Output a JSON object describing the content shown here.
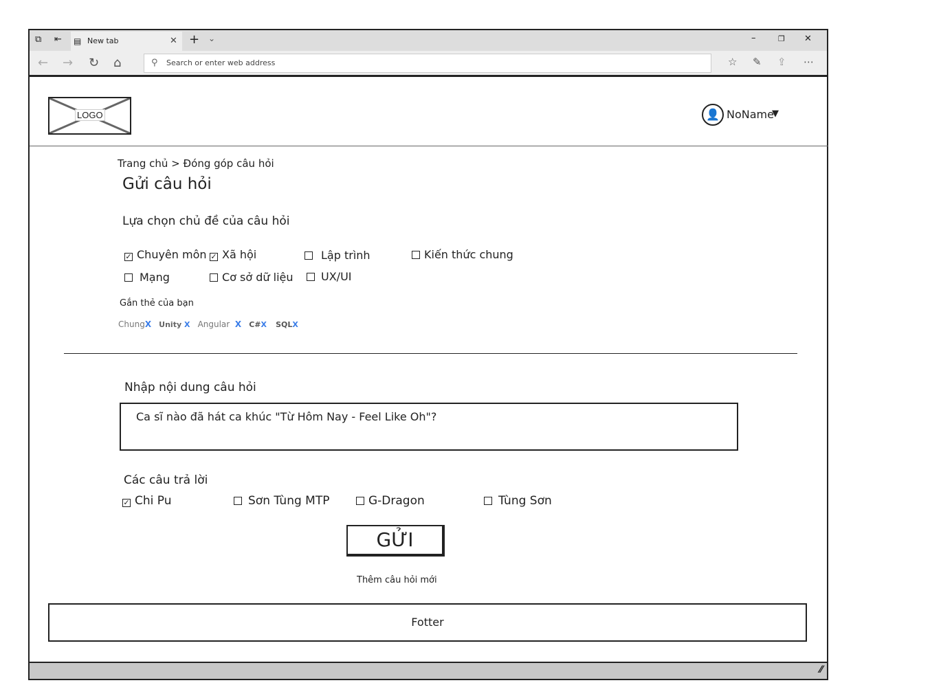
{
  "browser": {
    "tab_title": "New tab",
    "address_placeholder": "Search or enter web address"
  },
  "header": {
    "logo": "LOGO",
    "user": "NoName"
  },
  "breadcrumb": {
    "home": "Trang chủ",
    "separator": ">",
    "current": "Đóng góp câu hỏi"
  },
  "page_title": "Gửi câu hỏi",
  "topic": {
    "label": "Lựa chọn chủ đề của câu hỏi",
    "options": [
      {
        "label": "Chuyên môn",
        "checked": true
      },
      {
        "label": "Xã hội",
        "checked": true
      },
      {
        "label": "Lập trình",
        "checked": false
      },
      {
        "label": "Kiến thức chung",
        "checked": false
      },
      {
        "label": "Mạng",
        "checked": false
      },
      {
        "label": "Cơ sở dữ liệu",
        "checked": false
      },
      {
        "label": "UX/UI",
        "checked": false
      }
    ]
  },
  "tags": {
    "label": "Gắn thẻ của bạn",
    "items": [
      "Chung",
      "Unity",
      "Angular",
      "C#",
      "SQL"
    ],
    "remove": "X"
  },
  "question": {
    "label": "Nhập nội dung câu hỏi",
    "value": "Ca sĩ nào đã hát ca khúc \"Từ Hôm Nay - Feel Like Oh\"?"
  },
  "answers": {
    "label": "Các câu trả lời",
    "options": [
      {
        "label": "Chi Pu",
        "checked": true
      },
      {
        "label": "Sơn Tùng MTP",
        "checked": false
      },
      {
        "label": "G-Dragon",
        "checked": false
      },
      {
        "label": "Tùng Sơn",
        "checked": false
      }
    ]
  },
  "submit": "GỬI",
  "new_question": "Thêm câu hỏi mới",
  "footer": "Fotter"
}
